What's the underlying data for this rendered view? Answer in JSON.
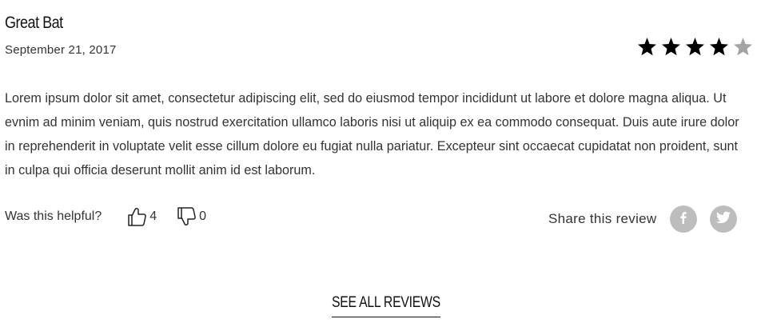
{
  "review": {
    "title": "Great Bat",
    "date": "September 21, 2017",
    "rating": 4,
    "rating_max": 5,
    "body": "Lorem ipsum dolor sit amet, consectetur adipiscing elit, sed do eiusmod tempor incididunt ut labore et dolore magna aliqua. Ut evnim ad minim veniam, quis nostrud exercitation ullamco laboris nisi ut aliquip ex ea commodo consequat. Duis aute irure dolor in reprehenderit in voluptate velit esse cillum dolore eu fugiat nulla pariatur. Excepteur sint occaecat cupidatat non proident, sunt in culpa qui officia deserunt mollit anim id est laborum."
  },
  "helpful": {
    "label": "Was this helpful?",
    "up_count": "4",
    "down_count": "0",
    "up_icon": "thumbs-up-icon",
    "down_icon": "thumbs-down-icon"
  },
  "share": {
    "label": "Share this review",
    "facebook_icon": "facebook-icon",
    "twitter_icon": "twitter-icon"
  },
  "footer": {
    "see_all_label": "SEE ALL REVIEWS"
  },
  "colors": {
    "star_filled": "#000000",
    "star_empty": "#a3a3a3",
    "social_bg": "#bdbdbd",
    "text": "#333333"
  }
}
